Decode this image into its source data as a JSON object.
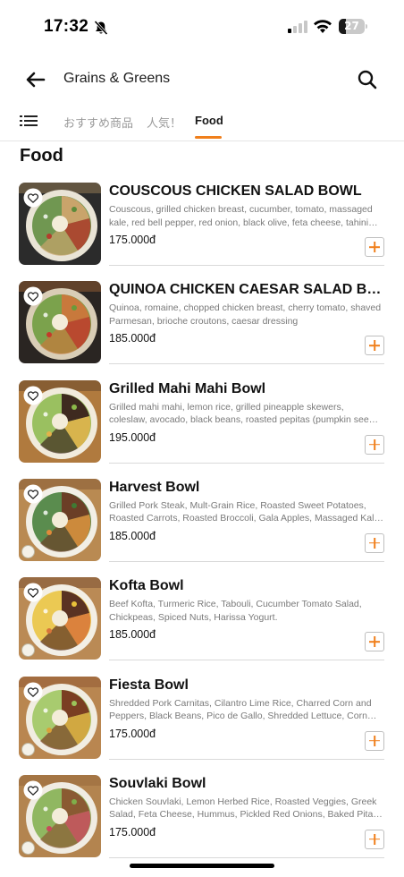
{
  "status_bar": {
    "time": "17:32",
    "battery_level": "27",
    "battery_fraction": 0.27
  },
  "header": {
    "store_name": "Grains & Greens",
    "back_icon": "arrow-left-icon",
    "search_icon": "search-icon"
  },
  "tabs": {
    "menu_icon": "list-icon",
    "items": [
      {
        "label": "おすすめ商品",
        "active": false
      },
      {
        "label": "人気！",
        "active": false
      },
      {
        "label": "Food",
        "active": true
      }
    ],
    "accent_color": "#f07f1b"
  },
  "section": {
    "title": "Food"
  },
  "menu": {
    "currency_note": "đ",
    "items": [
      {
        "name": "COUSCOUS CHICKEN SALAD BOWL",
        "description": "Couscous, grilled chicken breast, cucumber, tomato, massaged kale, red bell pepper, red onion, black olive, feta cheese, tahini…",
        "price": "175.000đ",
        "palette": [
          "#2b2b2b",
          "#e9e4d6",
          "#c9a46b",
          "#5b8a3a",
          "#b43c2c"
        ],
        "has_logo": false
      },
      {
        "name": "QUINOA CHICKEN CAESAR SALAD BO…",
        "description": "Quinoa, romaine, chopped chicken breast, cherry tomato, shaved Parmesan, brioche croutons, caesar dressing",
        "price": "185.000đ",
        "palette": [
          "#2a2522",
          "#d9cdb6",
          "#c8793c",
          "#6a9a3a",
          "#c43a2a"
        ],
        "has_logo": false
      },
      {
        "name": "Grilled Mahi Mahi Bowl",
        "description": "Grilled mahi mahi, lemon rice, grilled pineapple skewers, coleslaw, avocado, black beans, roasted pepitas (pumpkin see…",
        "price": "195.000đ",
        "palette": [
          "#b07a3e",
          "#f1ebdc",
          "#3e2a1f",
          "#8bb84a",
          "#e3b24a"
        ],
        "has_logo": false
      },
      {
        "name": "Harvest Bowl",
        "description": "Grilled Pork Steak, Mult-Grain Rice, Roasted Sweet Potatoes, Roasted Carrots, Roasted Broccoli, Gala Apples, Massaged Kal…",
        "price": "185.000đ",
        "palette": [
          "#b98a52",
          "#f2efe6",
          "#6b3e26",
          "#3f7a33",
          "#e08a3a"
        ],
        "has_logo": true
      },
      {
        "name": "Kofta Bowl",
        "description": "Beef Kofta, Turmeric Rice, Tabouli, Cucumber Tomato Salad, Chickpeas, Spiced Nuts, Harissa Yogurt.",
        "price": "185.000đ",
        "palette": [
          "#ba8a55",
          "#f3efe5",
          "#5a3222",
          "#e9c23a",
          "#d8753a"
        ],
        "has_logo": true
      },
      {
        "name": "Fiesta Bowl",
        "description": "Shredded Pork Carnitas, Cilantro Lime Rice, Charred Corn and Peppers, Black Beans, Pico de Gallo, Shredded Lettuce, Corn C…",
        "price": "175.000đ",
        "palette": [
          "#b98650",
          "#f1ede2",
          "#7a3e22",
          "#9bc45a",
          "#d8a23a"
        ],
        "has_logo": true
      },
      {
        "name": "Souvlaki Bowl",
        "description": "Chicken Souvlaki, Lemon Herbed Rice, Roasted Veggies, Greek Salad, Feta Cheese, Hummus, Pickled Red Onions, Baked Pita…",
        "price": "175.000đ",
        "palette": [
          "#b3844f",
          "#f0ece3",
          "#8a5a32",
          "#7fae4a",
          "#c74a5a"
        ],
        "has_logo": true
      }
    ]
  }
}
